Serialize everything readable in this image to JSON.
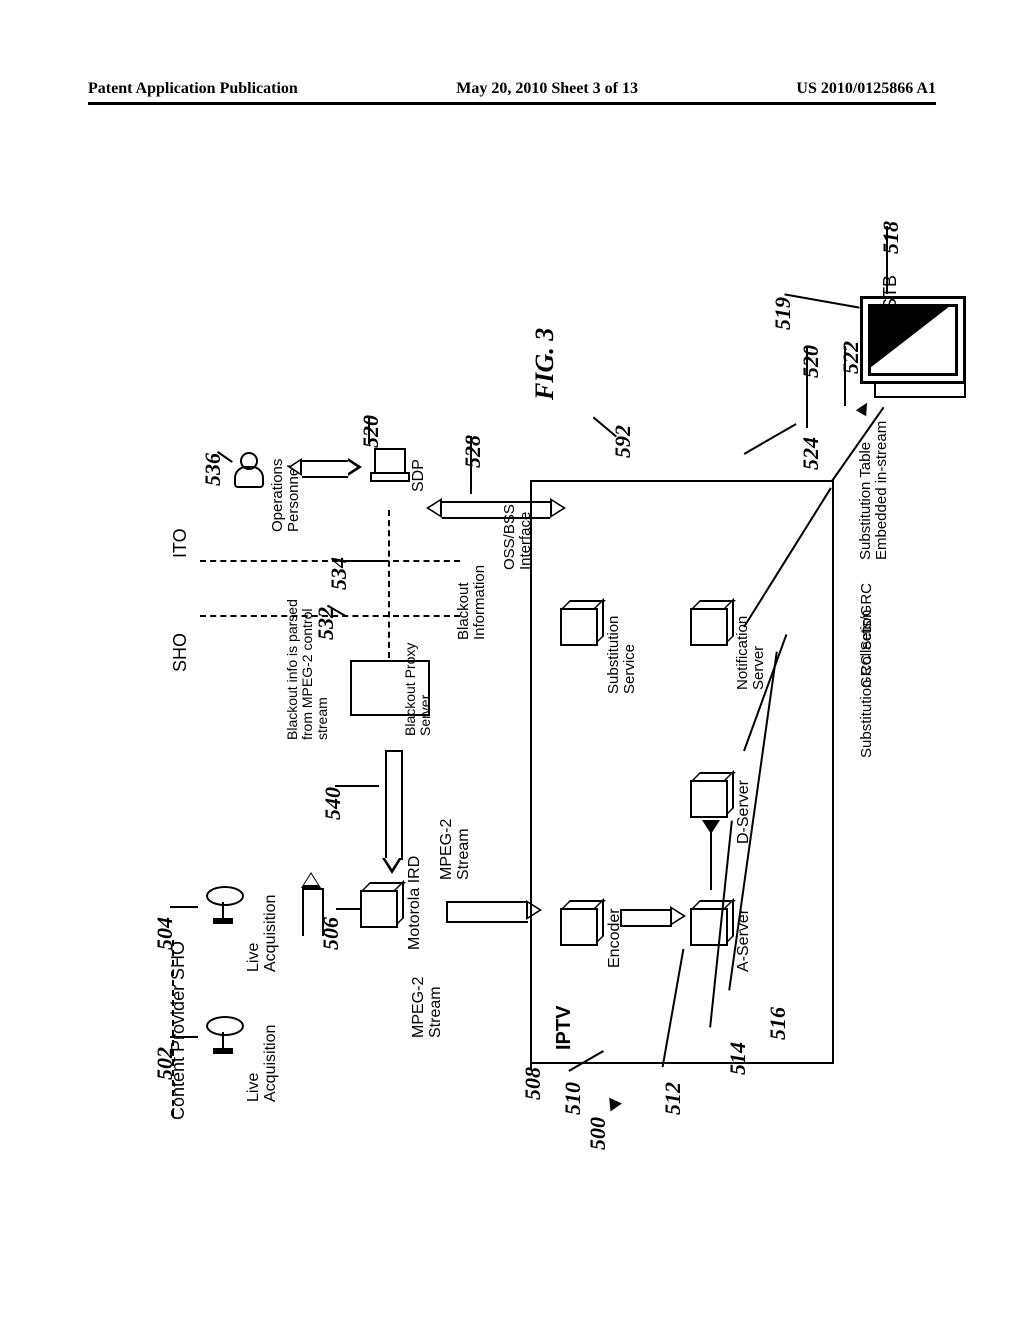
{
  "header": {
    "left": "Patent Application Publication",
    "center": "May 20, 2010  Sheet 3 of 13",
    "right": "US 2010/0125866 A1"
  },
  "labels": {
    "content_provider": "Content Provider",
    "sho_header": "SHO",
    "live_acq_1": "Live\nAcquisition",
    "live_acq_2": "Live\nAcquisition",
    "motorola_ird": "Motorola IRD",
    "mpeg2_1": "MPEG-2\nStream",
    "mpeg2_2": "MPEG-2\nStream",
    "blackout_parsed": "Blackout info is parsed\nfrom MPEG-2 control\nstream",
    "blackout_proxy": "Blackout Proxy\nServer",
    "sho_side": "SHO",
    "ito_side": "ITO",
    "operations_personnel": "Operations\nPersonnel",
    "blackout_info": "Blackout\nInformation",
    "sdp": "SDP",
    "oss_bss": "OSS/BSS\nInterface",
    "iptv": "IPTV",
    "encoder": "Encoder",
    "a_server": "A-Server",
    "d_server": "D-Server",
    "notification_server": "Notification\nServer",
    "substitution_service": "Substitution\nService",
    "sub_collection": "Substitution Collection",
    "grc_sets": "GRC Sets/GRC",
    "sub_table": "Substitution Table\nEmbedded in-stream",
    "stb": "STB",
    "fig": "FIG. 3"
  },
  "refs": {
    "r500": "500",
    "r502": "502",
    "r504": "504",
    "r506": "506",
    "r508": "508",
    "r510": "510",
    "r512": "512",
    "r514": "514",
    "r516": "516",
    "r518": "518",
    "r519": "519",
    "r520a": "520",
    "r520b": "520",
    "r522": "522",
    "r524": "524",
    "r528": "528",
    "r532": "532",
    "r534": "534",
    "r536": "536",
    "r540": "540",
    "r592": "592"
  }
}
